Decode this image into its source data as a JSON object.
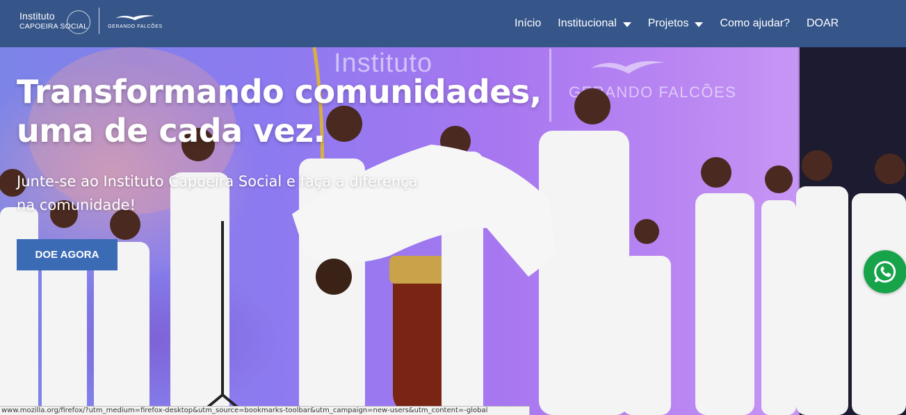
{
  "logo": {
    "instituto": "Instituto",
    "capoeira_social": "CAPOEIRA SOCIAL",
    "gerando_falcoes": "GERANDO FALCÕES"
  },
  "nav": {
    "items": [
      {
        "label": "Início",
        "has_dropdown": false
      },
      {
        "label": "Institucional",
        "has_dropdown": true
      },
      {
        "label": "Projetos",
        "has_dropdown": true
      },
      {
        "label": "Como ajudar?",
        "has_dropdown": false
      },
      {
        "label": "DOAR",
        "has_dropdown": false
      }
    ]
  },
  "hero": {
    "title": "Transformando comunidades, uma de cada vez.",
    "subtitle": "Junte-se ao Instituto Capoeira Social e faça a diferença na comunidade!",
    "cta_label": "DOE AGORA",
    "background_text": {
      "instituto": "Instituto",
      "gerando_falcoes": "GERANDO FALCÕES"
    }
  },
  "whatsapp": {
    "icon": "whatsapp-icon"
  },
  "status_bar": {
    "url": "www.mozilla.org/firefox/?utm_medium=firefox-desktop&utm_source=bookmarks-toolbar&utm_campaign=new-users&utm_content=-global"
  },
  "colors": {
    "header_bg": "#36568a",
    "cta_bg": "#3c6bb6",
    "whatsapp_bg": "#16a34a"
  }
}
